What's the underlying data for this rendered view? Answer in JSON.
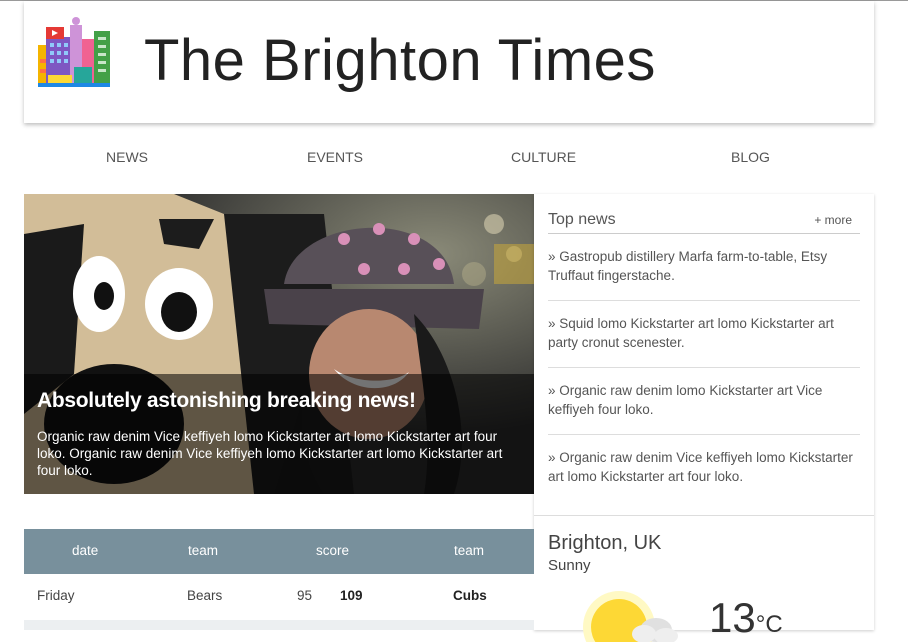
{
  "site": {
    "title": "The Brighton Times"
  },
  "nav": {
    "items": [
      "NEWS",
      "EVENTS",
      "CULTURE",
      "BLOG"
    ]
  },
  "hero": {
    "headline": "Absolutely astonishing breaking news!",
    "text": "Organic raw denim Vice keffiyeh lomo Kickstarter art lomo Kickstarter art four loko. Organic raw denim Vice keffiyeh lomo Kickstarter art lomo Kickstarter art four loko."
  },
  "top_news": {
    "title": "Top news",
    "more": "+ more",
    "items": [
      "» Gastropub distillery Marfa farm-to-table, Etsy Truffaut fingerstache.",
      "» Squid lomo Kickstarter art lomo Kickstarter art party cronut scenester.",
      "» Organic raw denim lomo Kickstarter art Vice keffiyeh four loko.",
      "» Organic raw denim Vice keffiyeh lomo Kickstarter art lomo Kickstarter art four loko."
    ]
  },
  "weather": {
    "city": "Brighton, UK",
    "condition": "Sunny",
    "temp": "13",
    "unit": "°C"
  },
  "scores": {
    "headers": [
      "date",
      "team",
      "score",
      "team"
    ],
    "rows": [
      {
        "date": "Friday",
        "team1": "Bears",
        "score1": "95",
        "score2": "109",
        "team2": "Cubs"
      }
    ]
  },
  "colors": {
    "table_header": "#78909c",
    "accent_yellow": "#fdd835"
  }
}
